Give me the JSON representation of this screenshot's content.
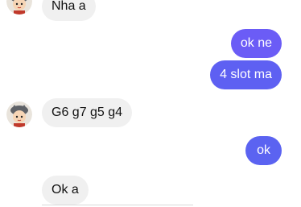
{
  "colors": {
    "outgoing_bubble": "#6b5cf6",
    "incoming_bubble": "#f0f0f0"
  },
  "avatar": {
    "icon": "cartoon-character-avatar"
  },
  "messages": [
    {
      "from": "them",
      "text": "Nha a"
    },
    {
      "from": "me",
      "text": "ok ne"
    },
    {
      "from": "me",
      "text": "4 slot ma"
    },
    {
      "from": "them",
      "text": "G6 g7 g5 g4"
    },
    {
      "from": "me",
      "text": "ok"
    },
    {
      "from": "them",
      "text": "Ok a"
    }
  ]
}
